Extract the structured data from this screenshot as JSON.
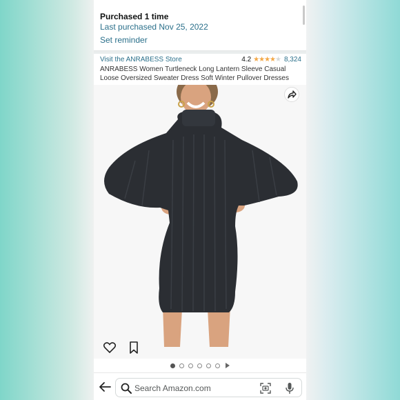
{
  "purchase": {
    "title": "Purchased 1 time",
    "last_purchased": "Last purchased Nov 25, 2022",
    "reminder": "Set reminder"
  },
  "product": {
    "store_link": "Visit the ANRABESS Store",
    "rating": "4.2",
    "rating_value": 4.2,
    "review_count": "8,324",
    "title": "ANRABESS Women Turtleneck Long Lantern Sleeve Casual Loose Oversized Sweater Dress Soft Winter Pullover Dresses"
  },
  "image": {
    "icons": [
      "share-icon",
      "heart-icon",
      "bookmark-icon"
    ],
    "carousel_dots": 6,
    "active_dot": 0,
    "has_video_indicator": true
  },
  "search": {
    "placeholder": "Search Amazon.com",
    "icons": [
      "back-arrow-icon",
      "search-icon",
      "camera-scan-icon",
      "microphone-icon"
    ]
  },
  "colors": {
    "link": "#2a6f8a",
    "star": "#f3a847",
    "dress": "#2b2e33",
    "skin": "#d9a37f"
  }
}
